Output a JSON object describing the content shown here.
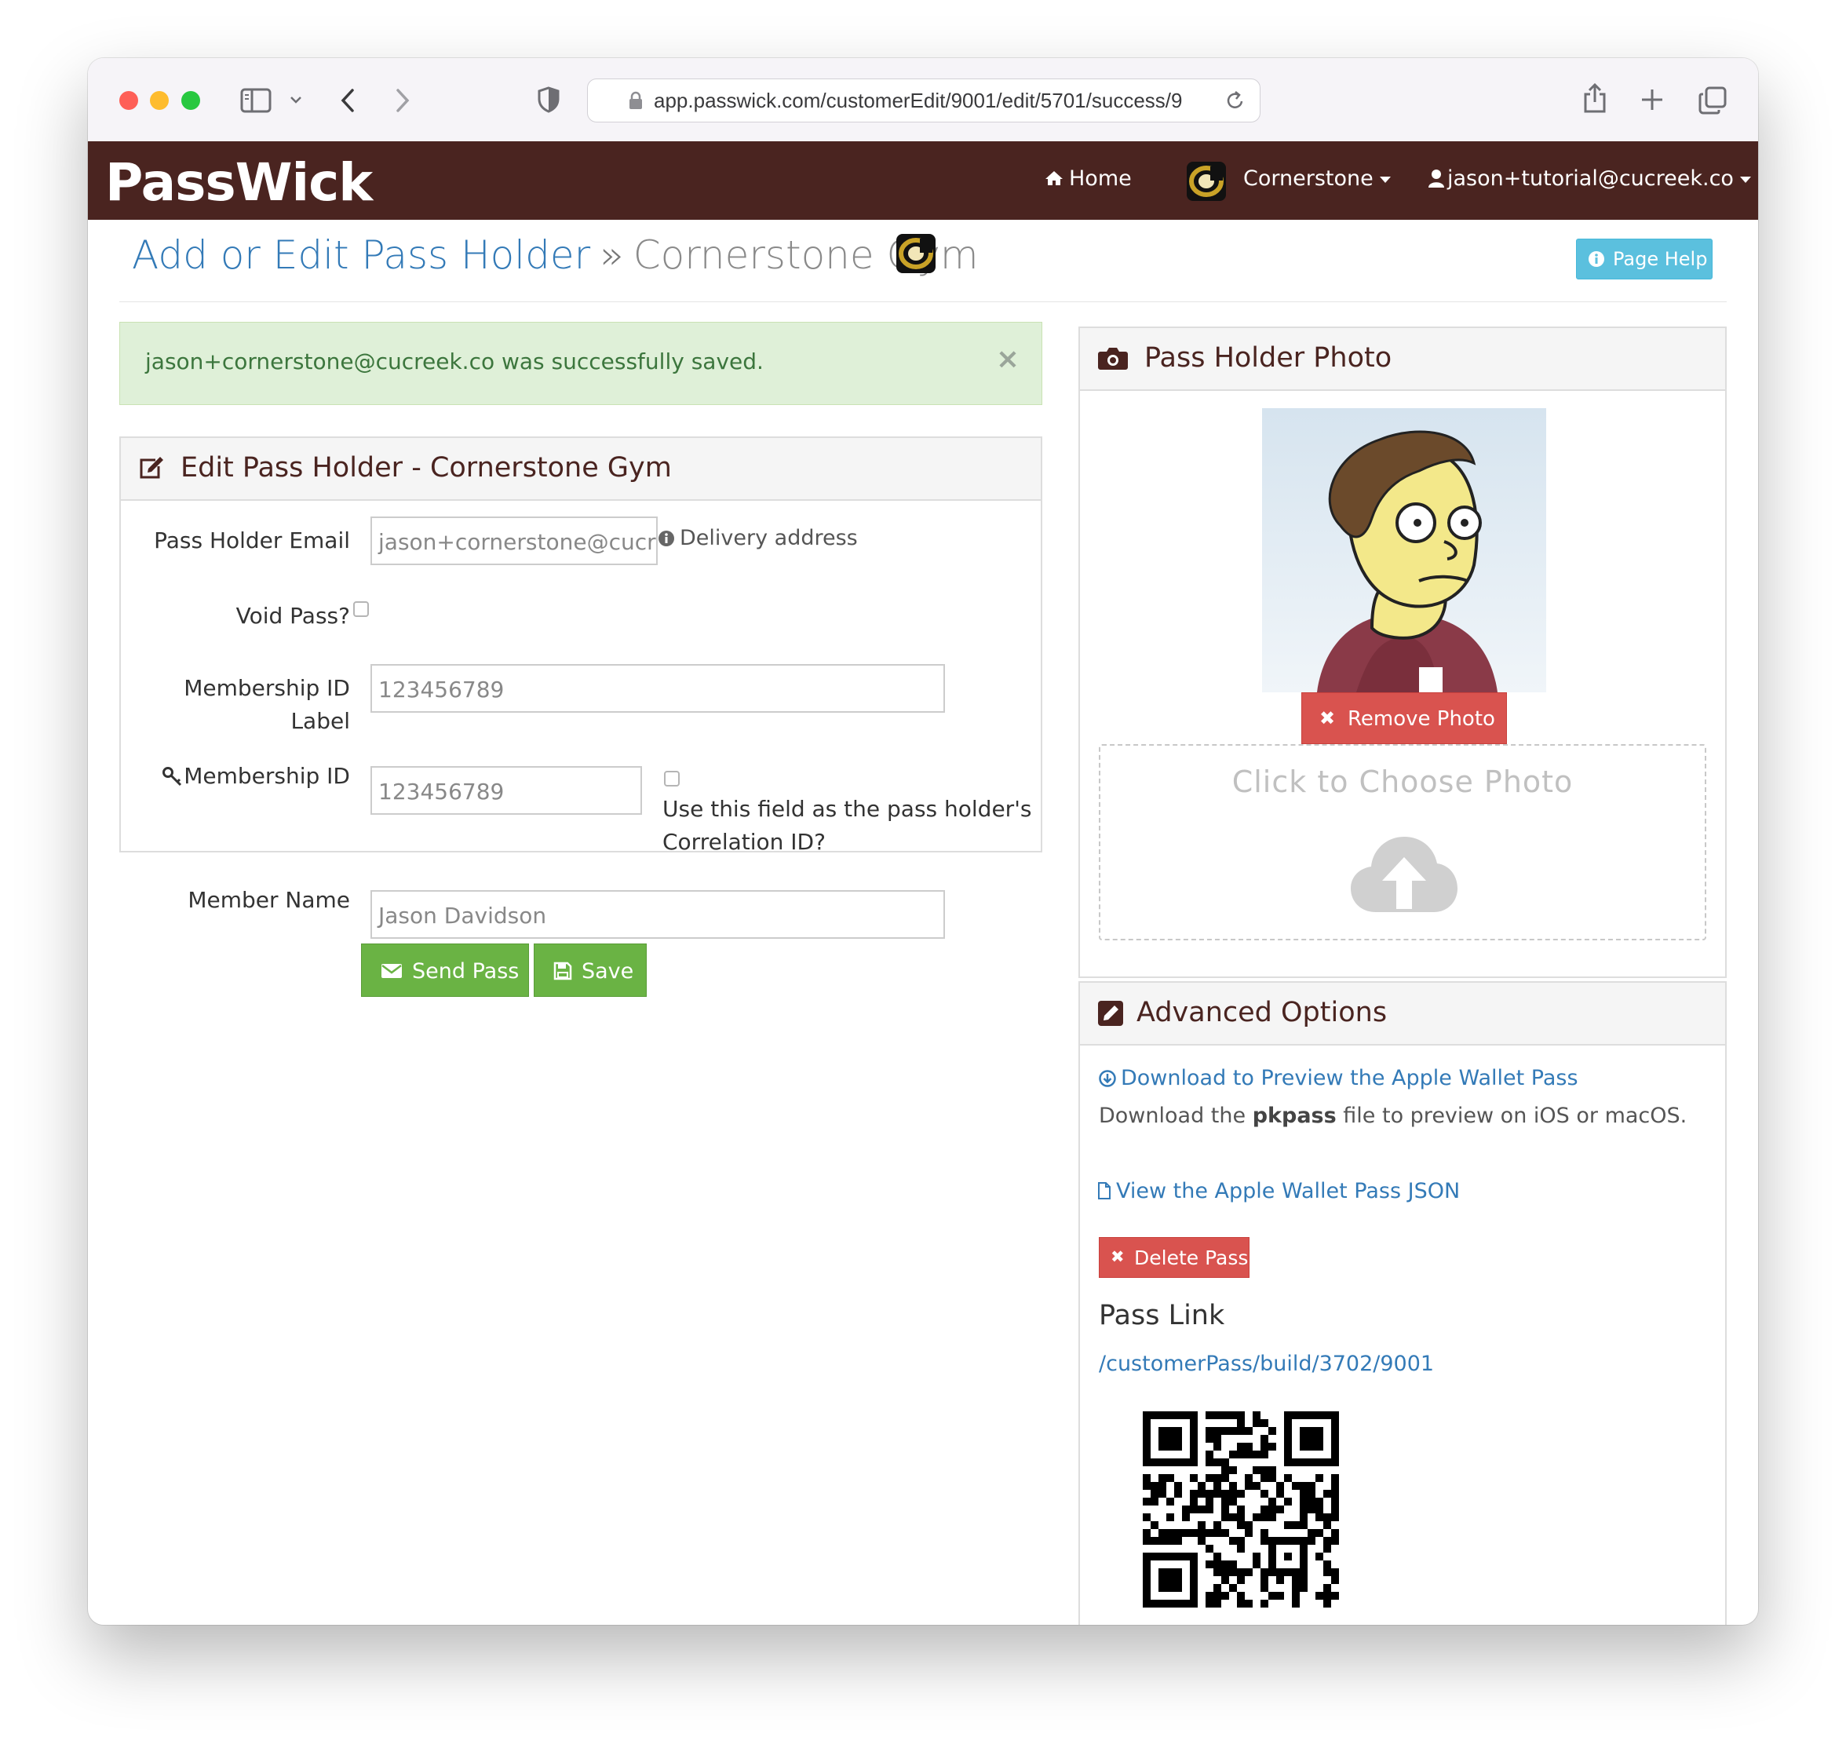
{
  "browser": {
    "url": "app.passwick.com/customerEdit/9001/edit/5701/success/9"
  },
  "navbar": {
    "brand": "PassWick",
    "home": "Home",
    "org": "Cornerstone",
    "user": "jason+tutorial@cucreek.co"
  },
  "page": {
    "title": "Add or Edit Pass Holder",
    "separator": "»",
    "subtitle": "Cornerstone Gym",
    "help_button": "Page Help"
  },
  "alert": {
    "message": "jason+cornerstone@cucreek.co was successfully saved.",
    "close": "×"
  },
  "edit_panel": {
    "title": "Edit Pass Holder - Cornerstone Gym",
    "email_label": "Pass Holder Email",
    "email_value": "jason+cornerstone@cucreek.co",
    "email_hint": "Delivery address",
    "void_label": "Void Pass?",
    "membership_label_label_line1": "Membership ID",
    "membership_label_label_line2": "Label",
    "membership_label_value": "123456789",
    "membership_id_label": "Membership ID",
    "membership_id_value": "123456789",
    "correlation_line1": "Use this field as the pass holder's",
    "correlation_line2": "Correlation ID?",
    "member_name_label": "Member Name",
    "member_name_value": "Jason Davidson",
    "send_button": "Send Pass",
    "save_button": "Save"
  },
  "photo_panel": {
    "title": "Pass Holder Photo",
    "remove_button": "Remove Photo",
    "dropzone_text": "Click to Choose Photo"
  },
  "advanced_panel": {
    "title": "Advanced Options",
    "download_link": "Download to Preview the Apple Wallet Pass",
    "download_desc_prefix": "Download the",
    "download_desc_bold": "pkpass",
    "download_desc_suffix": "file to preview on iOS or macOS.",
    "json_link": "View the Apple Wallet Pass JSON",
    "delete_button": "Delete Pass",
    "pass_link_heading": "Pass Link",
    "pass_link_url": "/customerPass/build/3702/9001"
  },
  "colors": {
    "navbar": "#4a2420",
    "link": "#337ab7",
    "success_bg": "#dff0d8",
    "success_text": "#3c763d",
    "button_green": "#6ab344",
    "button_red": "#d9534f",
    "button_info": "#5bc0de"
  },
  "icons": [
    "sidebar-icon",
    "chevron-down-icon",
    "back-icon",
    "forward-icon",
    "shield-icon",
    "lock-icon",
    "reload-icon",
    "share-icon",
    "plus-icon",
    "tabs-icon",
    "home-icon",
    "user-icon",
    "info-icon",
    "edit-icon",
    "key-icon",
    "envelope-icon",
    "floppy-icon",
    "camera-icon",
    "close-icon",
    "cloud-upload-icon",
    "pencil-square-icon",
    "download-icon",
    "file-icon",
    "qr-code-icon"
  ]
}
